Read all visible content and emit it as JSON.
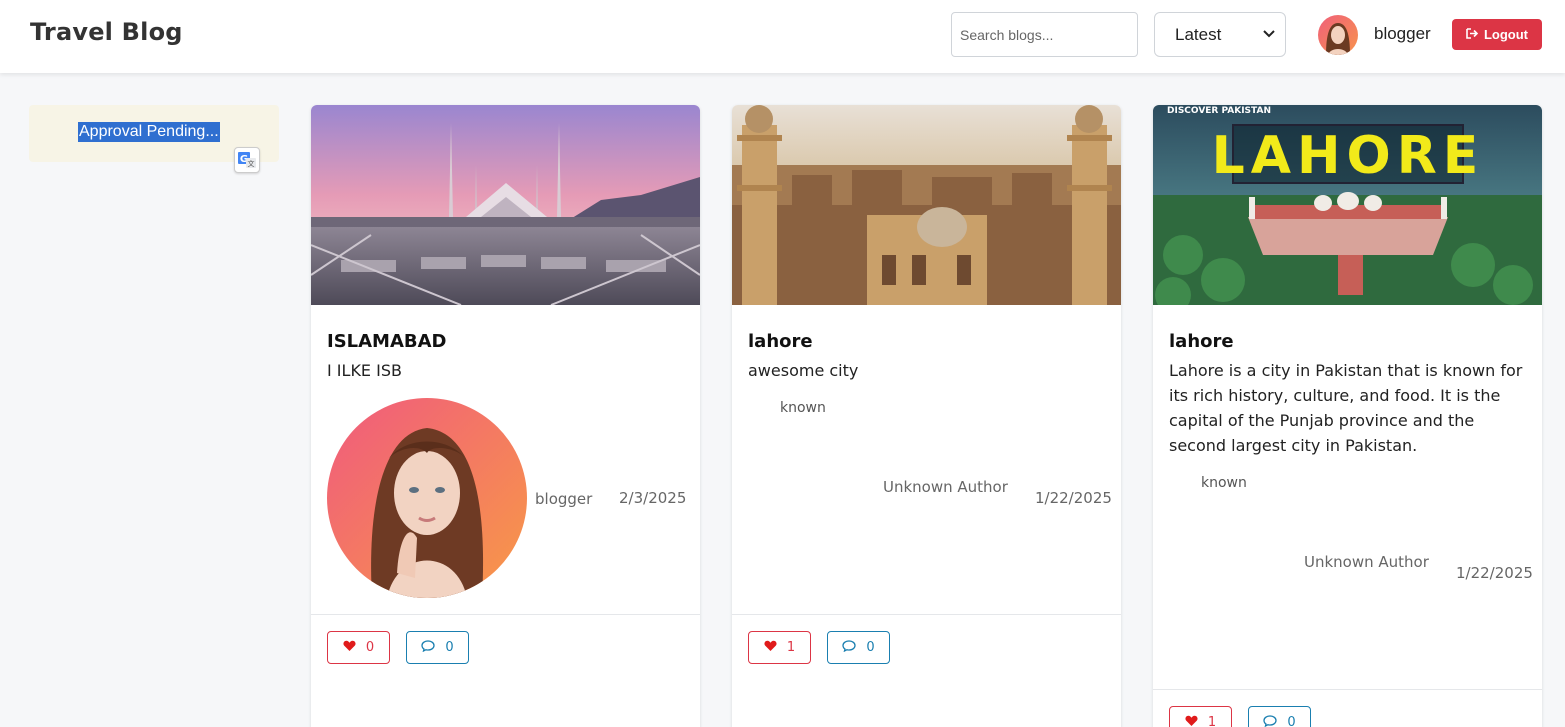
{
  "header": {
    "brand": "Travel Blog",
    "search_placeholder": "Search blogs...",
    "sort_selected": "Latest",
    "username": "blogger",
    "logout_label": "Logout"
  },
  "sidebar": {
    "notice": "Approval Pending..."
  },
  "posts": [
    {
      "title": "ISLAMABAD",
      "description": "I ILKE ISB",
      "author": "blogger",
      "date": "2/3/2025",
      "likes": "0",
      "comments": "0"
    },
    {
      "title": "lahore",
      "description": "awesome city",
      "avatar_alt": "known",
      "author": "Unknown Author",
      "date": "1/22/2025",
      "likes": "1",
      "comments": "0"
    },
    {
      "title": "lahore",
      "description": "Lahore is a city in Pakistan that is known for its rich history, culture, and food. It is the capital of the Punjab province and the second largest city in Pakistan.",
      "image_caption": "LAHORE",
      "image_badge": "DISCOVER PAKISTAN",
      "avatar_alt": "known",
      "author": "Unknown Author",
      "date": "1/22/2025",
      "likes": "1",
      "comments": "0"
    }
  ],
  "colors": {
    "logout": "#dc3545",
    "like": "#dc3545",
    "comment": "#1a7fb0",
    "notice_bg": "#f7f4e6"
  }
}
